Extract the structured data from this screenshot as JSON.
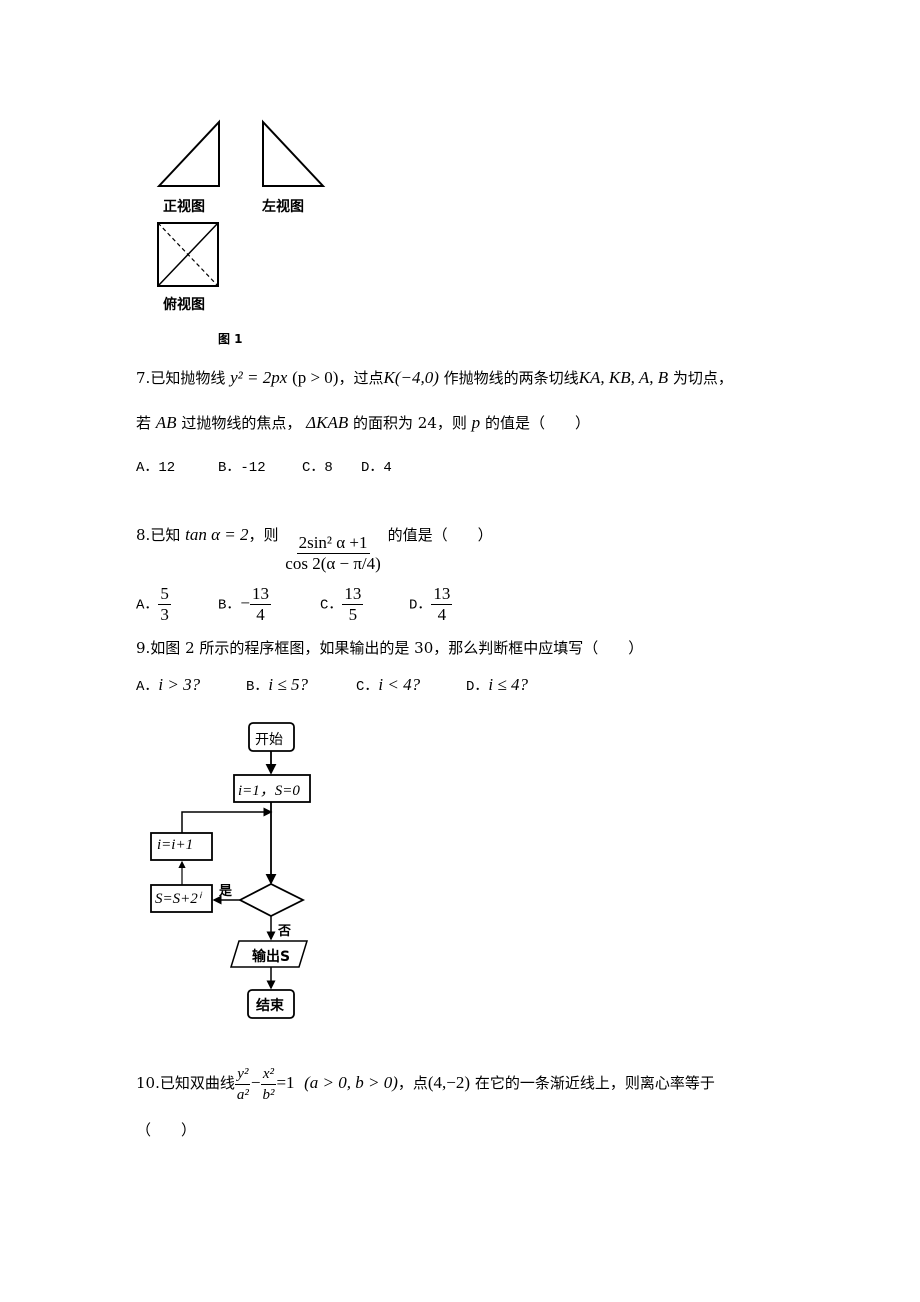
{
  "figure1": {
    "front_view_label": "正视图",
    "side_view_label": "左视图",
    "top_view_label": "俯视图",
    "caption": "图 1"
  },
  "q7": {
    "number": "7.",
    "text_a": "已知抛物线",
    "eq": "y² = 2px",
    "cond": "(p > 0)",
    "text_b": "，过点",
    "point": "K(−4,0)",
    "text_c": "作抛物线的两条切线",
    "lines": "KA, KB, A, B",
    "text_d": "为切点，",
    "line2_a": "若",
    "ab": "AB",
    "line2_b": "过抛物线的焦点，",
    "tri": "ΔKAB",
    "line2_c": "的面积为 24，则",
    "p": "p",
    "line2_d": "的值是（　　）",
    "options": [
      "A．12",
      "B．-12",
      "C．8",
      "D．4"
    ]
  },
  "q8": {
    "number": "8.",
    "text_a": "已知",
    "eq": "tan α = 2",
    "text_b": "，则",
    "numerator": "2sin² α +1",
    "denominator": "cos 2(α − π/4)",
    "text_c": "的值是（　　）",
    "options": [
      {
        "label": "A．",
        "sign": "",
        "num": "5",
        "den": "3"
      },
      {
        "label": "B．",
        "sign": "−",
        "num": "13",
        "den": "4"
      },
      {
        "label": "C．",
        "sign": "",
        "num": "13",
        "den": "5"
      },
      {
        "label": "D．",
        "sign": "",
        "num": "13",
        "den": "4"
      }
    ]
  },
  "q9": {
    "text": "9.如图 2 所示的程序框图，如果输出的是 30，那么判断框中应填写（　　）",
    "options": [
      {
        "label": "A．",
        "expr": "i > 3?"
      },
      {
        "label": "B．",
        "expr": "i ≤ 5?"
      },
      {
        "label": "C．",
        "expr": "i < 4?"
      },
      {
        "label": "D．",
        "expr": "i ≤ 4?"
      }
    ]
  },
  "flowchart": {
    "start": "开始",
    "init": "i=1，S=0",
    "increment": "i=i+1",
    "accumulate": "S=S+2ⁱ",
    "yes": "是",
    "no": "否",
    "output": "输出S",
    "end": "结束"
  },
  "q10": {
    "number": "10.",
    "text_a": "已知双曲线",
    "frac1_num": "y²",
    "frac1_den": "a²",
    "frac2_num": "x²",
    "frac2_den": "b²",
    "eq_rest": "=1",
    "cond": "(a > 0, b > 0)",
    "text_b": "，点",
    "point": "(4,−2)",
    "text_c": "在它的一条渐近线上，则离心率等于",
    "line2": "（　　）"
  }
}
